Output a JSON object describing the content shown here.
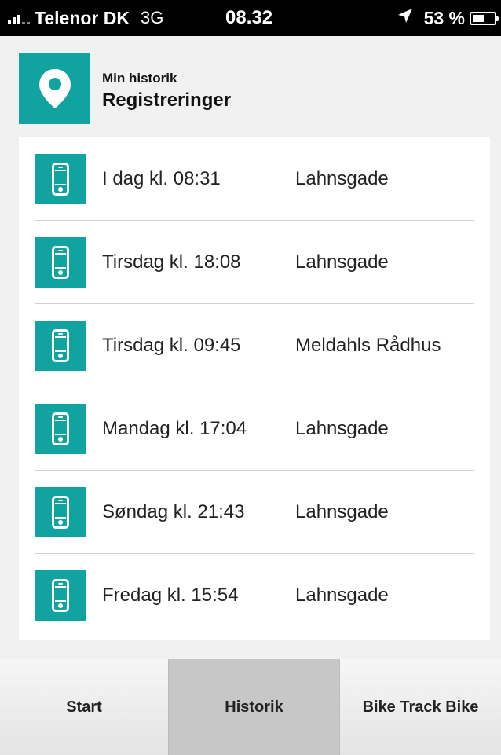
{
  "status_bar": {
    "carrier": "Telenor DK",
    "network": "3G",
    "time": "08.32",
    "battery": "53 %",
    "battery_level": 0.53
  },
  "header": {
    "subtitle": "Min historik",
    "title": "Registreringer",
    "icon": "location-pin-icon"
  },
  "registrations": [
    {
      "time": "I dag kl. 08:31",
      "place": "Lahnsgade"
    },
    {
      "time": "Tirsdag kl. 18:08",
      "place": "Lahnsgade"
    },
    {
      "time": "Tirsdag kl. 09:45",
      "place": "Meldahls Rådhus"
    },
    {
      "time": "Mandag kl. 17:04",
      "place": "Lahnsgade"
    },
    {
      "time": "Søndag kl. 21:43",
      "place": "Lahnsgade"
    },
    {
      "time": "Fredag kl. 15:54",
      "place": "Lahnsgade"
    }
  ],
  "tabs": [
    {
      "label": "Start",
      "active": false
    },
    {
      "label": "Historik",
      "active": true
    },
    {
      "label": "Bike Track Bike",
      "active": false
    }
  ],
  "colors": {
    "accent": "#11a3a0",
    "background": "#f1f1f1",
    "tab_active": "#c7c7c7"
  }
}
